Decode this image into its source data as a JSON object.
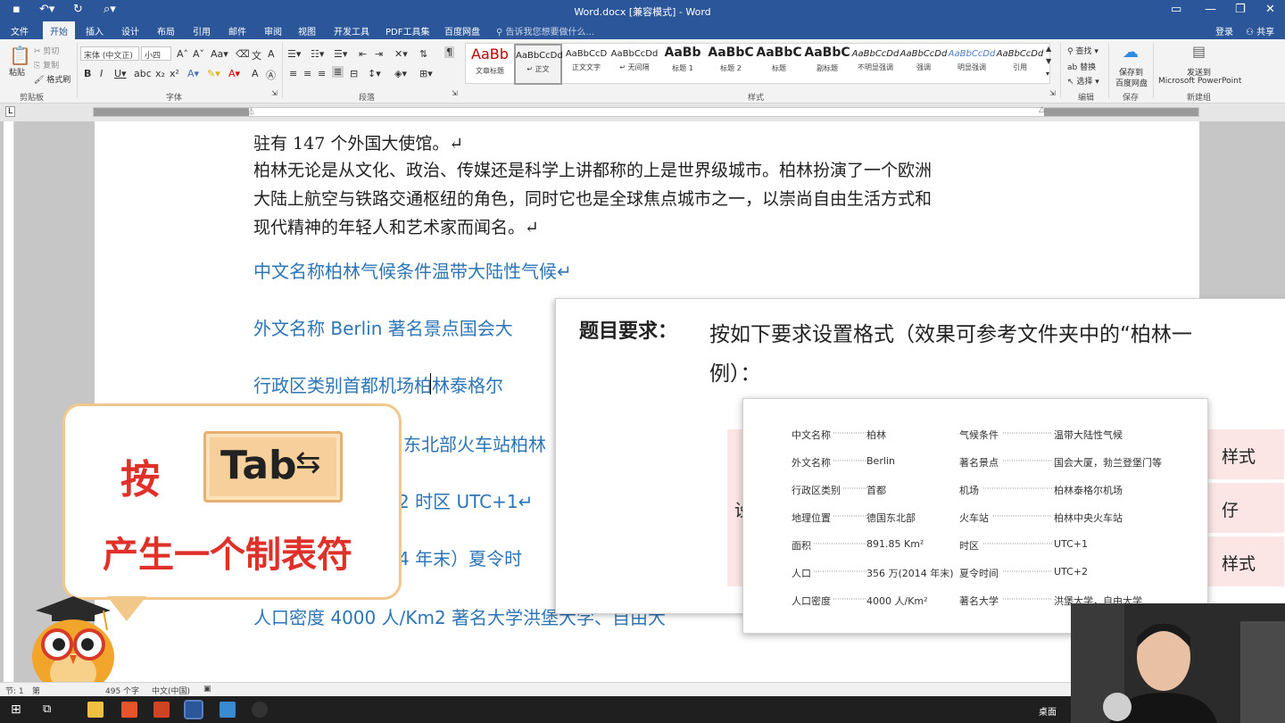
{
  "window": {
    "title": "Word.docx [兼容模式] - Word"
  },
  "tabs": [
    "文件",
    "开始",
    "插入",
    "设计",
    "布局",
    "引用",
    "邮件",
    "审阅",
    "视图",
    "开发工具",
    "PDF工具集",
    "百度网盘"
  ],
  "tell_me": "告诉我您想要做什么...",
  "account": {
    "login": "登录",
    "share": "共享"
  },
  "ribbon": {
    "clipboard": {
      "paste": "粘贴",
      "cut": "剪切",
      "copy": "复制",
      "painter": "格式刷",
      "label": "剪贴板"
    },
    "font": {
      "name": "宋体 (中文正)",
      "size": "小四",
      "label": "字体"
    },
    "paragraph": {
      "label": "段落"
    },
    "styles_label": "样式",
    "styles": [
      {
        "preview": "AaBb",
        "name": "文章标题"
      },
      {
        "preview": "AaBbCcDd",
        "name": "↵ 正文"
      },
      {
        "preview": "AaBbCcD",
        "name": "正文文字"
      },
      {
        "preview": "AaBbCcDd",
        "name": "↵ 无间隔"
      },
      {
        "preview": "AaBb",
        "name": "标题 1"
      },
      {
        "preview": "AaBbC",
        "name": "标题 2"
      },
      {
        "preview": "AaBbC",
        "name": "标题"
      },
      {
        "preview": "AaBbC",
        "name": "副标题"
      },
      {
        "preview": "AaBbCcDd",
        "name": "不明显强调"
      },
      {
        "preview": "AaBbCcDd",
        "name": "强调"
      },
      {
        "preview": "AaBbCcDd",
        "name": "明显强调"
      },
      {
        "preview": "AaBbCcDd",
        "name": "引用"
      }
    ],
    "editing": {
      "find": "查找",
      "replace": "替换",
      "select": "选择",
      "label": "编辑"
    },
    "save": {
      "line1": "保存到",
      "line2": "百度网盘",
      "label": "保存"
    },
    "send": {
      "line1": "发送到",
      "line2": "Microsoft PowerPoint",
      "label": "新建组"
    }
  },
  "document": {
    "lines": [
      "驻有 147 个外国大使馆。↵",
      "柏林无论是从文化、政治、传媒还是科学上讲都称的上是世界级城市。柏林扮演了一个欧洲",
      "大陆上航空与铁路交通枢纽的角色，同时它也是全球焦点城市之一，以崇尚自由生活方式和",
      "现代精神的年轻人和艺术家而闻名。↵"
    ],
    "blue_lines": [
      "中文名称柏林气候条件温带大陆性气候↵",
      "外文名称 Berlin 著名景点国会大",
      "行政区类别首都机场柏林泰格尔",
      "东北部火车站柏林",
      "2 时区 UTC+1↵",
      "4 年末）夏令时",
      "人口密度 4000 人/Km2 著名大学洪堡大学、自由大"
    ]
  },
  "overlay": {
    "label": "题目要求：",
    "requirement_line1": "按如下要求设置格式（效果可参考文件夹中的“柏林一",
    "requirement_line2": "例）：",
    "right_fragments": [
      "样式",
      "仔",
      "样式"
    ],
    "left_fragment": "设"
  },
  "sample_table": [
    {
      "k1": "中文名称",
      "v1": "柏林",
      "k2": "气候条件",
      "v2": "温带大陆性气候"
    },
    {
      "k1": "外文名称",
      "v1": "Berlin",
      "k2": "著名景点",
      "v2": "国会大厦，勃兰登堡门等"
    },
    {
      "k1": "行政区类别",
      "v1": "首都",
      "k2": "机场",
      "v2": "柏林泰格尔机场"
    },
    {
      "k1": "地理位置",
      "v1": "德国东北部",
      "k2": "火车站",
      "v2": "柏林中央火车站"
    },
    {
      "k1": "面积",
      "v1": "891.85 Km²",
      "k2": "时区",
      "v2": "UTC+1"
    },
    {
      "k1": "人口",
      "v1": "356 万(2014 年末)",
      "k2": "夏令时间",
      "v2": "UTC+2"
    },
    {
      "k1": "人口密度",
      "v1": "4000 人/Km²",
      "k2": "著名大学",
      "v2": "洪堡大学，自由大学"
    }
  ],
  "callout": {
    "press": "按",
    "key": "Tab",
    "result": "产生一个制表符"
  },
  "statusbar": {
    "section": "节: 1",
    "page": "第",
    "words": "495 个字",
    "language": "中文(中国)"
  },
  "taskbar": {
    "desktop": "桌面"
  },
  "colors": {
    "word_blue": "#2b579a",
    "heading_blue": "#2e75b6",
    "callout_red": "#e0302a"
  }
}
